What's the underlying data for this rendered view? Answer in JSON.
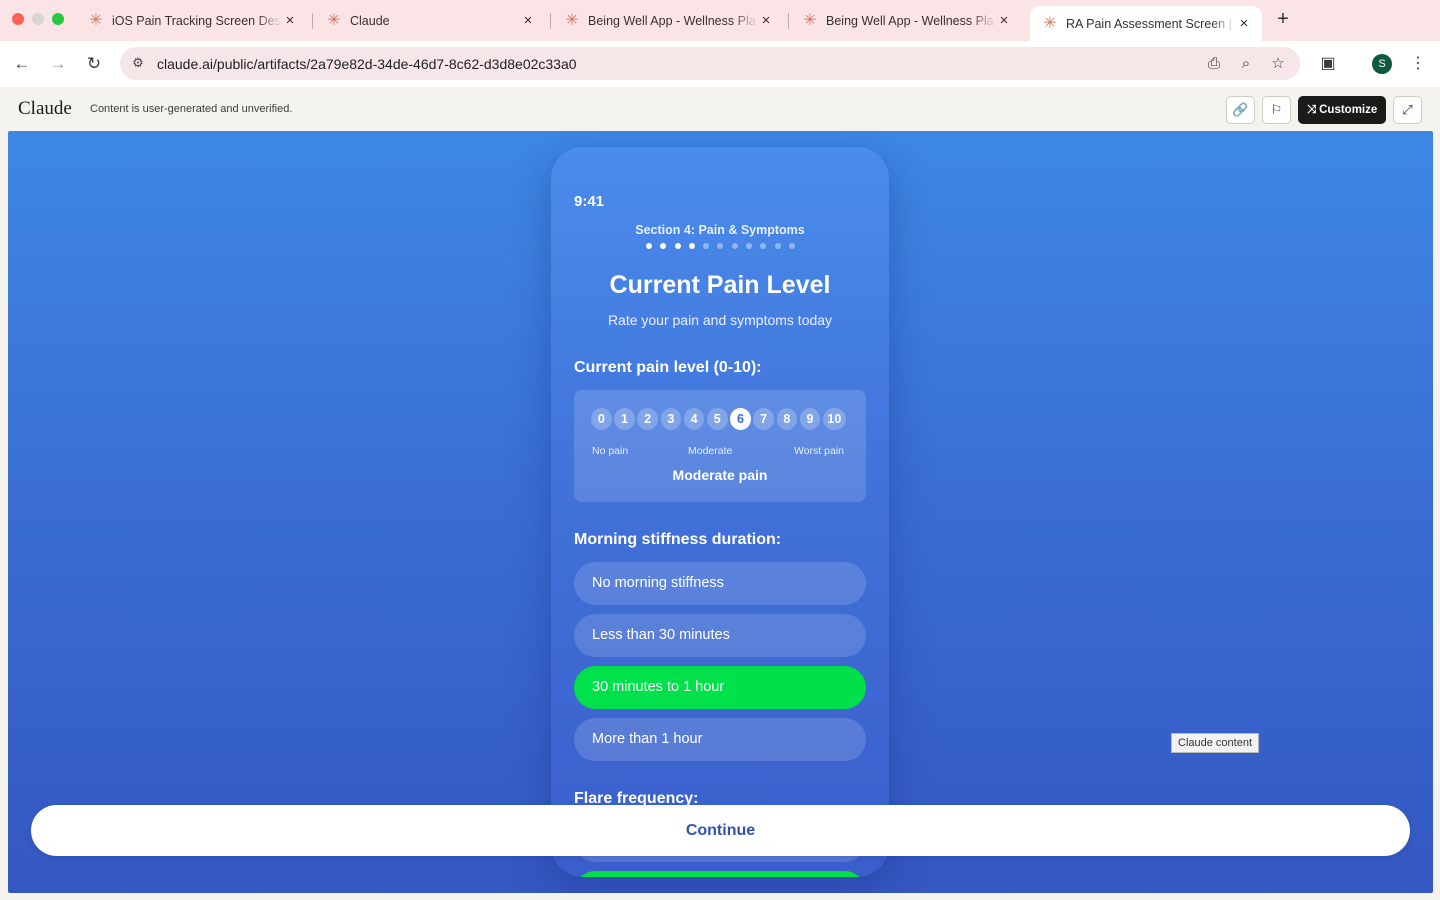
{
  "browser": {
    "tabs": [
      {
        "title": "iOS Pain Tracking Screen Des",
        "active": false
      },
      {
        "title": "Claude",
        "active": false
      },
      {
        "title": "Being Well App - Wellness Pla",
        "active": false
      },
      {
        "title": "Being Well App - Wellness Pla",
        "active": false
      },
      {
        "title": "RA Pain Assessment Screen |",
        "active": true
      }
    ],
    "tab_close_glyph": "×",
    "new_tab_glyph": "+",
    "url": "claude.ai/public/artifacts/2a79e82d-34de-46d7-8c62-d3d8e02c33a0",
    "profile_initial": "S"
  },
  "claude_header": {
    "logo": "Claude",
    "note": "Content is user-generated and unverified.",
    "customize_label": "Customize"
  },
  "app": {
    "time": "9:41",
    "section": "Section 4: Pain & Symptoms",
    "progress": {
      "total": 11,
      "completed": 4
    },
    "title": "Current Pain Level",
    "subtitle": "Rate your pain and symptoms today",
    "pain_question": "Current pain level (0-10):",
    "pain_scale": [
      "0",
      "1",
      "2",
      "3",
      "4",
      "5",
      "6",
      "7",
      "8",
      "9",
      "10"
    ],
    "pain_selected": 6,
    "scale_labels": {
      "low": "No pain",
      "mid": "Moderate",
      "high": "Worst pain"
    },
    "pain_description": "Moderate pain",
    "stiffness_question": "Morning stiffness duration:",
    "stiffness_options": [
      {
        "label": "No morning stiffness",
        "selected": false
      },
      {
        "label": "Less than 30 minutes",
        "selected": false
      },
      {
        "label": "30 minutes to 1 hour",
        "selected": true
      },
      {
        "label": "More than 1 hour",
        "selected": false
      }
    ],
    "flare_question": "Flare frequency:",
    "continue_label": "Continue"
  },
  "tooltip": "Claude content",
  "colors": {
    "selected_option": "#00e04a",
    "background_top": "#3e88e5",
    "background_bottom": "#3457c2",
    "continue_text": "#3251b5"
  }
}
